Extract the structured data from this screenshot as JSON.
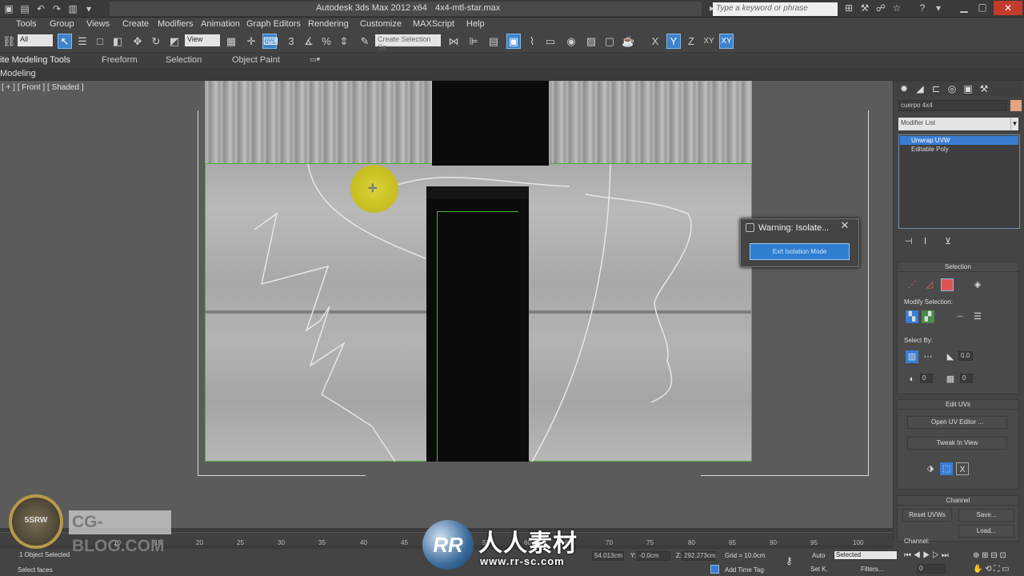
{
  "window": {
    "app_title": "Autodesk 3ds Max  2012 x64",
    "file_name": "4x4-mtl-star.max",
    "search_placeholder": "Type a keyword or phrase"
  },
  "menu": [
    "Tools",
    "Group",
    "Views",
    "Create",
    "Modifiers",
    "Animation",
    "Graph Editors",
    "Rendering",
    "Customize",
    "MAXScript",
    "Help"
  ],
  "toolbar": {
    "filter_value": "All",
    "refcoord_value": "View",
    "selection_set_placeholder": "Create Selection Se",
    "axis_x": "X",
    "axis_y": "Y",
    "axis_z": "Z",
    "axis_xy": "XY",
    "axis_xy2": "XY"
  },
  "ribbon": {
    "tabs": [
      "ite Modeling Tools",
      "Freeform",
      "Selection",
      "Object Paint"
    ],
    "sub_label": "Modeling"
  },
  "viewport": {
    "label": "[ + ] [ Front ] [ Shaded ]"
  },
  "dialog": {
    "title": "Warning: Isolate...",
    "close": "✕",
    "button": "Exit Isolation Mode"
  },
  "command_panel": {
    "object_name": "cuerpo 4x4",
    "object_color": "#e3a581",
    "modifier_list": "Modifier List",
    "stack": [
      "Unwrap UVW",
      "Editable Poly"
    ],
    "selection": {
      "header": "Selection",
      "modify_selection": "Modify Selection:",
      "select_by": "Select By:",
      "spinner1": "0.0",
      "spinner2": "0",
      "spinner3": "0"
    },
    "edit_uvs": {
      "header": "Edit UVs",
      "open_uv_editor": "Open UV Editor ...",
      "tweak_in_view": "Tweak In View"
    },
    "channel": {
      "header": "Channel",
      "reset_uvws": "Reset UVWs",
      "save": "Save...",
      "load": "Load...",
      "channel_label": "Channel:"
    }
  },
  "timeline": {
    "ticks": [
      "10",
      "15",
      "20",
      "25",
      "30",
      "35",
      "40",
      "45",
      "50",
      "55",
      "60",
      "65",
      "70",
      "75",
      "80",
      "85",
      "90",
      "95",
      "100"
    ]
  },
  "status": {
    "selected_count": "1 Object Selected",
    "prompt": "Select faces",
    "x_value": "54.013cm",
    "y_label": "Y:",
    "y_value": "-0.0cm",
    "z_label": "Z:",
    "z_value": "292.273cm",
    "grid": "Grid = 10.0cm",
    "add_time_tag": "Add Time Tag",
    "auto": "Auto",
    "selected_dropdown": "Selected",
    "set_k": "Set K.",
    "filters": "Filters...",
    "frame": "0"
  },
  "watermarks": {
    "left_circle": "5SRW",
    "left_text": "CG-BLOG.COM",
    "rr_logo": "RR",
    "rr_cn": "人人素材",
    "rr_url": "www.rr-sc.com"
  }
}
